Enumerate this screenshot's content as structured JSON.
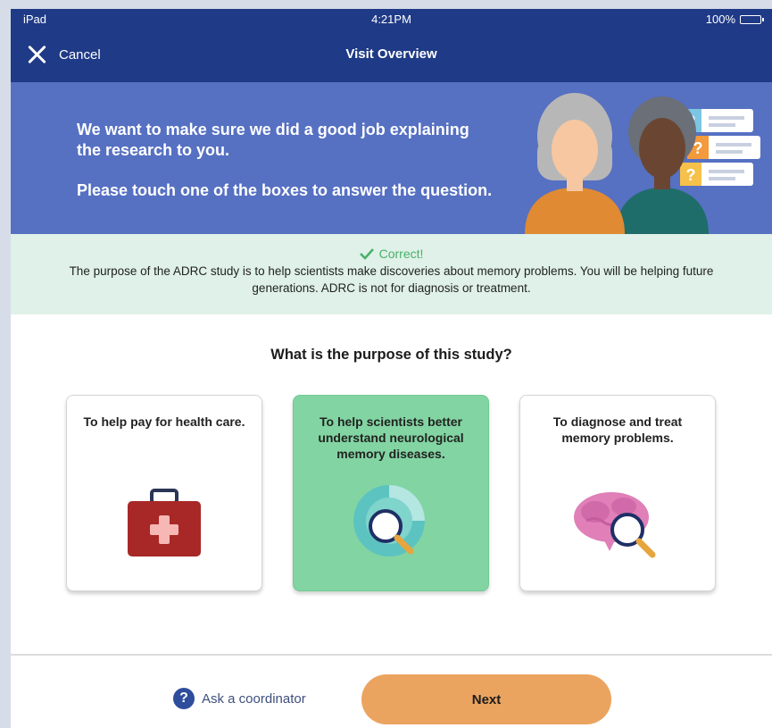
{
  "status_bar": {
    "device": "iPad",
    "time": "4:21PM",
    "battery": "100%"
  },
  "nav": {
    "cancel_label": "Cancel",
    "title": "Visit Overview"
  },
  "hero": {
    "line1": "We want to make sure we did a good job explaining the research to you.",
    "line2": "Please touch one of the boxes to answer the question."
  },
  "feedback": {
    "status": "Correct!",
    "message": "The purpose of the ADRC study is to help scientists make discoveries about memory problems. You will be helping future generations. ADRC is not for diagnosis or treatment."
  },
  "question": "What is the purpose of this study?",
  "options": [
    {
      "label": "To help pay for health care.",
      "icon": "medical-kit-icon",
      "selected": false
    },
    {
      "label": "To help scientists better understand neurological memory diseases.",
      "icon": "research-magnifier-icon",
      "selected": true
    },
    {
      "label": "To diagnose and treat memory problems.",
      "icon": "brain-magnifier-icon",
      "selected": false
    }
  ],
  "footer": {
    "ask_label": "Ask a coordinator",
    "next_label": "Next"
  },
  "colors": {
    "nav": "#1f3a86",
    "hero": "#5670c2",
    "feedback_bg": "#dff1e8",
    "correct": "#48b06a",
    "selected": "#82d5a2",
    "next": "#eba45f"
  }
}
